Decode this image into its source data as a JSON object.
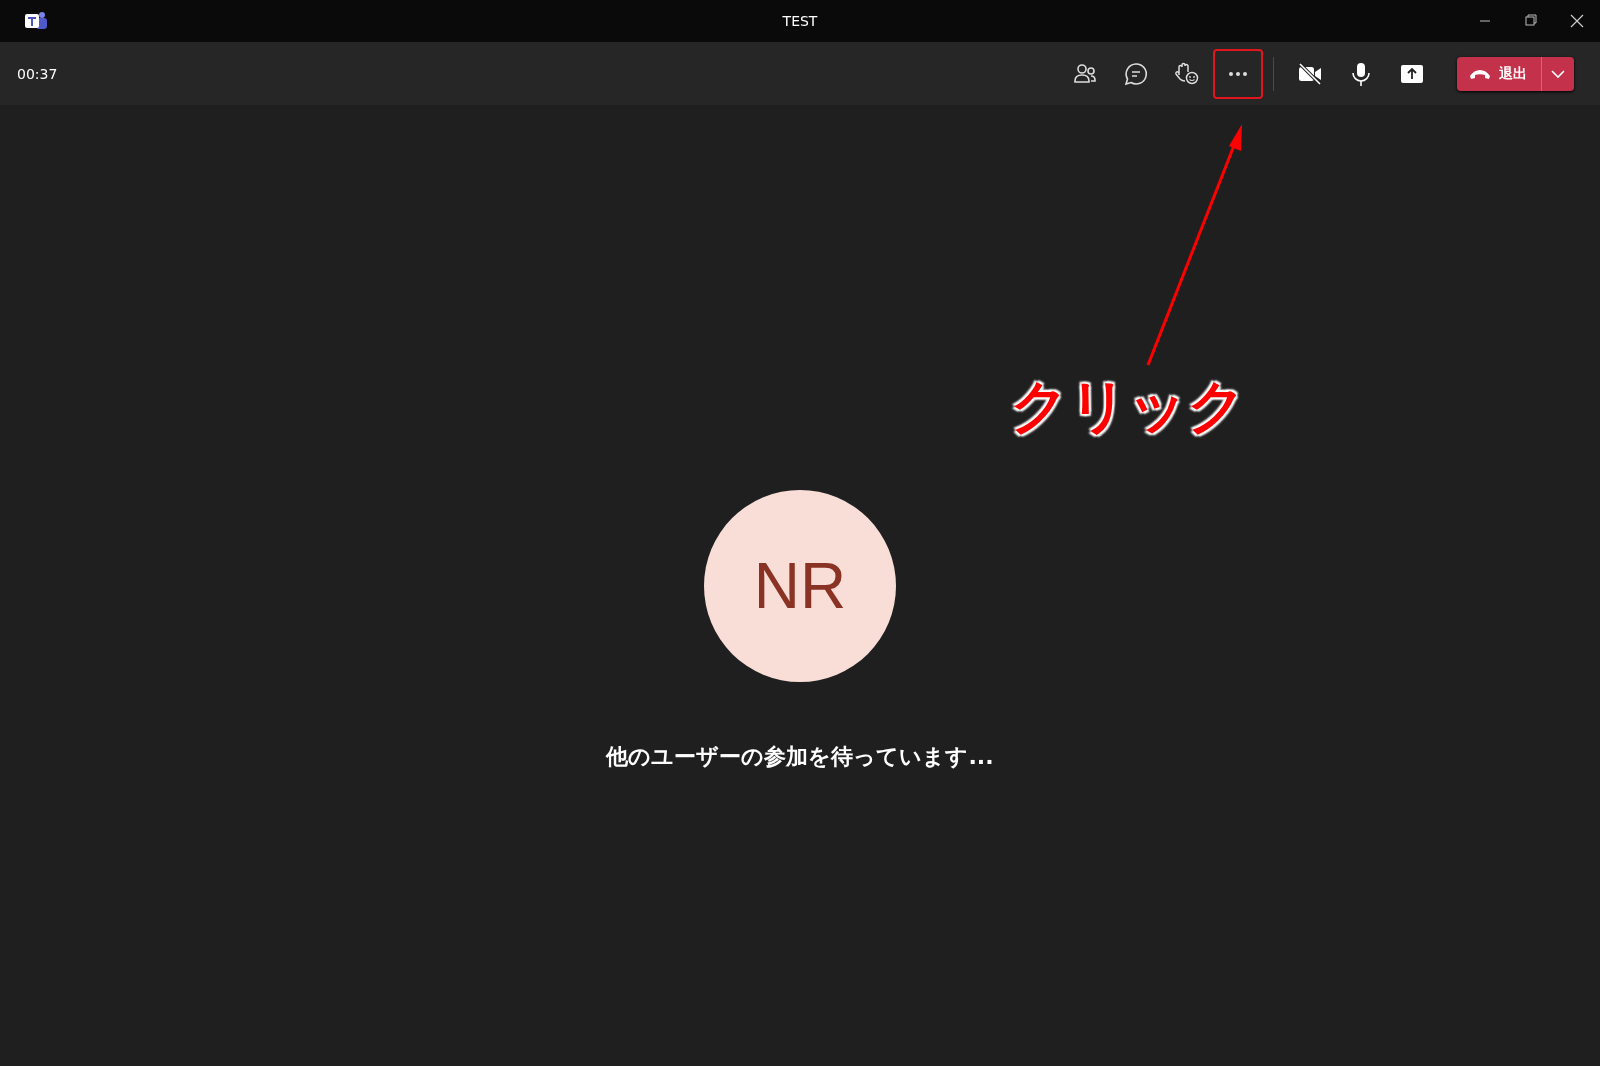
{
  "window": {
    "title": "TEST"
  },
  "toolbar": {
    "timer": "00:37",
    "buttons": [
      {
        "kind": "people",
        "highlighted": false
      },
      {
        "kind": "chat",
        "highlighted": false
      },
      {
        "kind": "reactions",
        "highlighted": false
      },
      {
        "kind": "more",
        "highlighted": true
      },
      {
        "kind": "divider"
      },
      {
        "kind": "camera-off",
        "highlighted": false
      },
      {
        "kind": "mic",
        "highlighted": false
      },
      {
        "kind": "share",
        "highlighted": false
      }
    ],
    "leave": {
      "label": "退出"
    }
  },
  "stage": {
    "avatar": {
      "initials": "NR"
    },
    "message": "他のユーザーの参加を待っています..."
  },
  "annotation": {
    "label": "クリック"
  }
}
